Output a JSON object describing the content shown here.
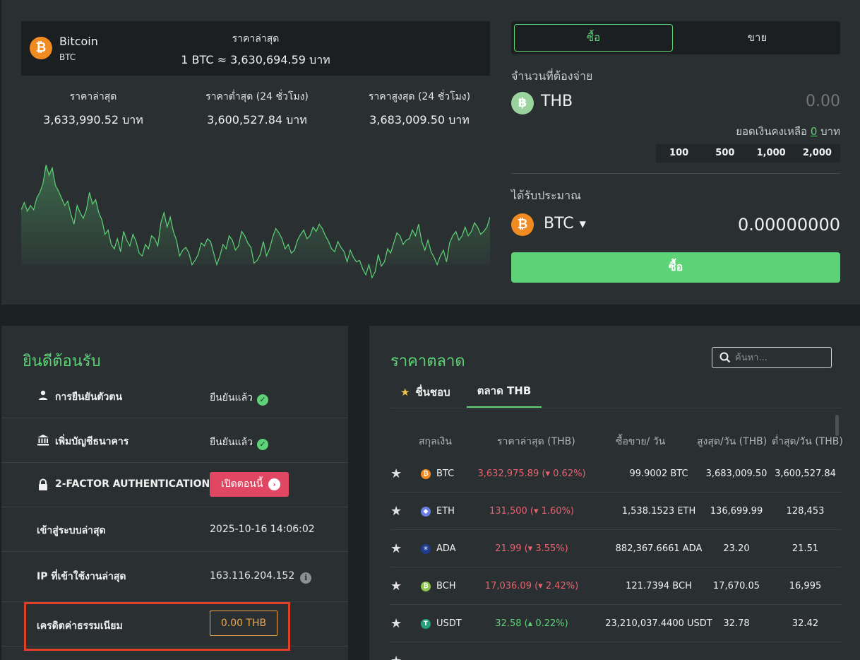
{
  "colors": {
    "accent": "#5ed276",
    "negative": "#e8616d",
    "warning": "#f0a64a",
    "danger_button": "#e14763",
    "btc": "#f08b22",
    "panel": "#2a3032"
  },
  "ticker": {
    "coin_name": "Bitcoin",
    "coin_symbol": "BTC",
    "last_price_label": "ราคาล่าสุด",
    "last_price_value": "1 BTC ≈ 3,630,694.59 บาท"
  },
  "stats": [
    {
      "label": "ราคาล่าสุด",
      "value": "3,633,990.52 บาท"
    },
    {
      "label": "ราคาต่ำสุด (24 ชั่วโมง)",
      "value": "3,600,527.84 บาท"
    },
    {
      "label": "ราคาสูงสุด (24 ชั่วโมง)",
      "value": "3,683,009.50 บาท"
    }
  ],
  "chart_data": {
    "type": "area",
    "title": "",
    "xlabel": "",
    "ylabel": "",
    "grid": false,
    "ylim": [
      3600000,
      3690000
    ],
    "values": [
      3648000,
      3653000,
      3647000,
      3651000,
      3648000,
      3656000,
      3660000,
      3666000,
      3679000,
      3672000,
      3677000,
      3665000,
      3661000,
      3656000,
      3651000,
      3654000,
      3645000,
      3638000,
      3651000,
      3646000,
      3642000,
      3648000,
      3660000,
      3652000,
      3655000,
      3646000,
      3641000,
      3631000,
      3634000,
      3624000,
      3621000,
      3628000,
      3619000,
      3633000,
      3627000,
      3623000,
      3631000,
      3626000,
      3618000,
      3616000,
      3624000,
      3621000,
      3630000,
      3628000,
      3623000,
      3639000,
      3646000,
      3636000,
      3643000,
      3633000,
      3627000,
      3616000,
      3620000,
      3622000,
      3618000,
      3610000,
      3613000,
      3617000,
      3625000,
      3623000,
      3628000,
      3626000,
      3618000,
      3610000,
      3616000,
      3624000,
      3621000,
      3630000,
      3627000,
      3620000,
      3623000,
      3633000,
      3630000,
      3625000,
      3622000,
      3611000,
      3613000,
      3617000,
      3626000,
      3616000,
      3621000,
      3629000,
      3635000,
      3632000,
      3628000,
      3621000,
      3624000,
      3618000,
      3620000,
      3627000,
      3631000,
      3634000,
      3628000,
      3630000,
      3636000,
      3633000,
      3638000,
      3635000,
      3630000,
      3626000,
      3621000,
      3619000,
      3626000,
      3622000,
      3619000,
      3612000,
      3620000,
      3615000,
      3612000,
      3613000,
      3607000,
      3603000,
      3610000,
      3601000,
      3605000,
      3617000,
      3609000,
      3612000,
      3621000,
      3618000,
      3625000,
      3632000,
      3630000,
      3624000,
      3627000,
      3628000,
      3634000,
      3630000,
      3638000,
      3626000,
      3620000,
      3627000,
      3619000,
      3615000,
      3610000,
      3616000,
      3620000,
      3612000,
      3625000,
      3630000,
      3633000,
      3627000,
      3630000,
      3636000,
      3630000,
      3633000,
      3639000,
      3636000,
      3631000,
      3633000,
      3636000,
      3643000
    ]
  },
  "trade": {
    "tab_buy": "ซื้อ",
    "tab_sell": "ขาย",
    "pay_label": "จำนวนที่ต้องจ่าย",
    "pay_icon": "baht-icon",
    "pay_currency": "THB",
    "pay_placeholder": "0.00",
    "balance_label": "ยอดเงินคงเหลือ",
    "balance_value": "0",
    "balance_unit": "บาท",
    "quick_amounts": [
      "100",
      "500",
      "1,000",
      "2,000"
    ],
    "receive_label": "ได้รับประมาณ",
    "receive_icon": "bitcoin-icon",
    "receive_currency": "BTC",
    "receive_amount": "0.00000000",
    "submit_label": "ซื้อ"
  },
  "welcome": {
    "title": "ยินดีต้อนรับ",
    "rows": [
      {
        "label": "การยืนยันตัวตน",
        "value": "ยืนยันแล้ว",
        "icon": "person-icon"
      },
      {
        "label": "เพิ่มบัญชีธนาคาร",
        "value": "ยืนยันแล้ว",
        "icon": "bank-icon"
      },
      {
        "label": "2-FACTOR AUTHENTICATION",
        "value": "เปิดตอนนี้",
        "icon": "lock-icon"
      },
      {
        "label": "เข้าสู่ระบบล่าสุด",
        "value": "2025-10-16 14:06:02"
      },
      {
        "label": "IP ที่เข้าใช้งานล่าสุด",
        "value": "163.116.204.152"
      },
      {
        "label": "เครดิตค่าธรรมเนียม",
        "value": "0.00 THB"
      }
    ]
  },
  "market": {
    "title": "ราคาตลาด",
    "search_placeholder": "ค้นหา...",
    "tab_favorites": "ชื่นชอบ",
    "tab_thb": "ตลาด THB",
    "columns": [
      "สกุลเงิน",
      "ราคาล่าสุด (THB)",
      "ซื้อขาย/ วัน",
      "สูงสุด/วัน (THB)",
      "ต่ำสุด/วัน (THB)"
    ],
    "rows": [
      {
        "symbol": "BTC",
        "icon": "bitcoin-icon",
        "icon_color": "#f08b22",
        "glyph": "₿",
        "price": "3,632,975.89 (▾ 0.62%)",
        "direction": "down",
        "volume": "99.9002 BTC",
        "high": "3,683,009.50",
        "low": "3,600,527.84"
      },
      {
        "symbol": "ETH",
        "icon": "ethereum-icon",
        "icon_color": "#6a7fe0",
        "glyph": "◆",
        "price": "131,500 (▾ 1.60%)",
        "direction": "down",
        "volume": "1,538.1523 ETH",
        "high": "136,699.99",
        "low": "128,453"
      },
      {
        "symbol": "ADA",
        "icon": "cardano-icon",
        "icon_color": "#1f3b8f",
        "glyph": "✳",
        "price": "21.99 (▾ 3.55%)",
        "direction": "down",
        "volume": "882,367.6661 ADA",
        "high": "23.20",
        "low": "21.51"
      },
      {
        "symbol": "BCH",
        "icon": "bitcoin-cash-icon",
        "icon_color": "#8cc351",
        "glyph": "₿",
        "price": "17,036.09 (▾ 2.42%)",
        "direction": "down",
        "volume": "121.7394 BCH",
        "high": "17,670.05",
        "low": "16,995"
      },
      {
        "symbol": "USDT",
        "icon": "tether-icon",
        "icon_color": "#26a17b",
        "glyph": "T",
        "price": "32.58 (▴ 0.22%)",
        "direction": "up",
        "volume": "23,210,037.4400 USDT",
        "high": "32.78",
        "low": "32.42"
      }
    ]
  }
}
